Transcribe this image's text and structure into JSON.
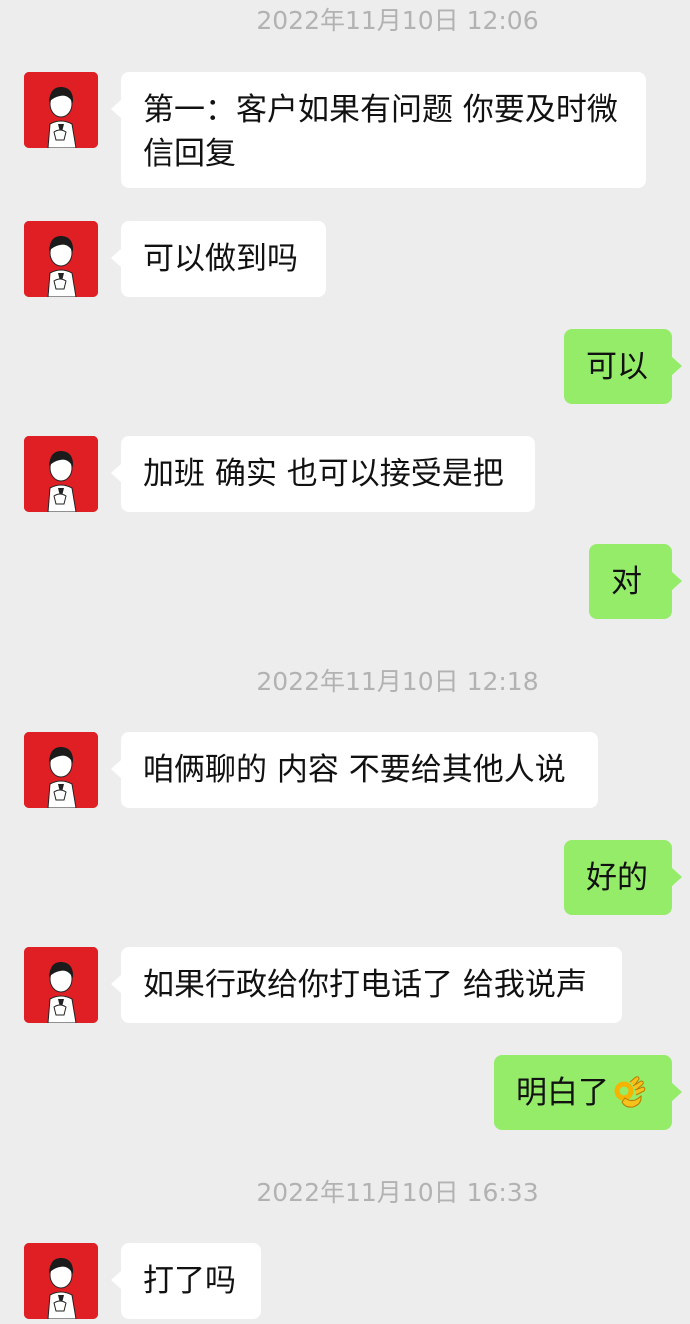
{
  "messages": [
    {
      "kind": "timestamp",
      "text": "2022年11月10日 12:06"
    },
    {
      "kind": "in",
      "text": "第一：客户如果有问题  你要及时微信回复"
    },
    {
      "kind": "in",
      "text": "可以做到吗"
    },
    {
      "kind": "out",
      "text": "可以"
    },
    {
      "kind": "in",
      "text": "加班 确实 也可以接受是把"
    },
    {
      "kind": "out",
      "text": "对"
    },
    {
      "kind": "timestamp",
      "text": "2022年11月10日 12:18"
    },
    {
      "kind": "in",
      "text": "咱俩聊的 内容 不要给其他人说"
    },
    {
      "kind": "out",
      "text": "好的"
    },
    {
      "kind": "in",
      "text": "如果行政给你打电话了 给我说声"
    },
    {
      "kind": "out",
      "text": "明白了",
      "emoji": "ok-hand-emoji"
    },
    {
      "kind": "timestamp",
      "text": "2022年11月10日 16:33"
    },
    {
      "kind": "in",
      "text": "打了吗"
    }
  ],
  "colors": {
    "background": "#ededed",
    "incoming_bubble": "#ffffff",
    "outgoing_bubble": "#95ec69",
    "timestamp_text": "#b2b2b2",
    "avatar_background": "#e01f25"
  }
}
